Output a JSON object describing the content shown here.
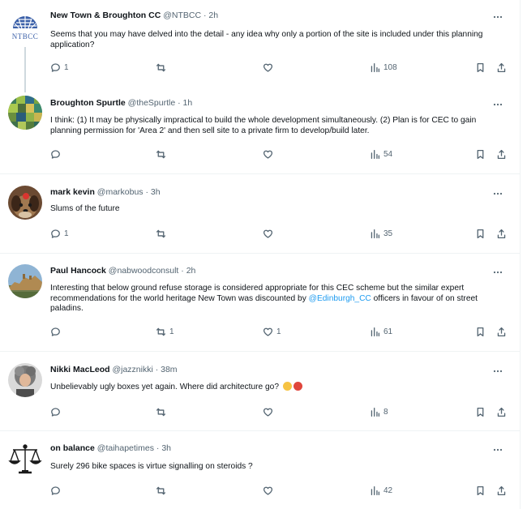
{
  "tweets": [
    {
      "name": "New Town & Broughton CC",
      "handle": "@NTBCC",
      "time": "· 2h",
      "avatar_text": "NTBCC",
      "text": "Seems that you may have delved into the detail - any idea why only a portion of the site is included under this planning application?",
      "replies": "1",
      "retweets": "",
      "likes": "",
      "views": "108"
    },
    {
      "name": "Broughton Spurtle",
      "handle": "@theSpurtle",
      "time": "· 1h",
      "text": "I think: (1) It may be physically impractical to build the whole development simultaneously. (2) Plan is for CEC to gain planning permission for 'Area 2' and then sell site to a private firm to develop/build later.",
      "replies": "",
      "retweets": "",
      "likes": "",
      "views": "54"
    },
    {
      "name": "mark kevin",
      "handle": "@markobus",
      "time": "· 3h",
      "text": "Slums of the future",
      "replies": "1",
      "retweets": "",
      "likes": "",
      "views": "35"
    },
    {
      "name": "Paul Hancock",
      "handle": "@nabwoodconsult",
      "time": "· 2h",
      "text_before": "Interesting that below ground refuse storage is considered appropriate for this CEC scheme but the similar expert recommendations for the world heritage New Town was discounted by ",
      "mention": "@Edinburgh_CC",
      "text_after": " officers in favour of on street paladins.",
      "replies": "",
      "retweets": "1",
      "likes": "1",
      "views": "61"
    },
    {
      "name": "Nikki MacLeod",
      "handle": "@jazznikki",
      "time": "· 38m",
      "text": "Unbelievably ugly boxes yet again. Where did architecture go?",
      "emojis": [
        "crying-face",
        "angry-face"
      ],
      "replies": "",
      "retweets": "",
      "likes": "",
      "views": "8"
    },
    {
      "name": "on balance",
      "handle": "@taihapetimes",
      "time": "· 3h",
      "text": "Surely 296 bike spaces is virtue signalling on steroids ?",
      "replies": "",
      "retweets": "",
      "likes": "",
      "views": "42"
    }
  ],
  "colors": {
    "text": "#0f1419",
    "muted": "#536471",
    "link": "#1d9bf0",
    "divider": "#eff3f4",
    "thread": "#cfd9de"
  }
}
